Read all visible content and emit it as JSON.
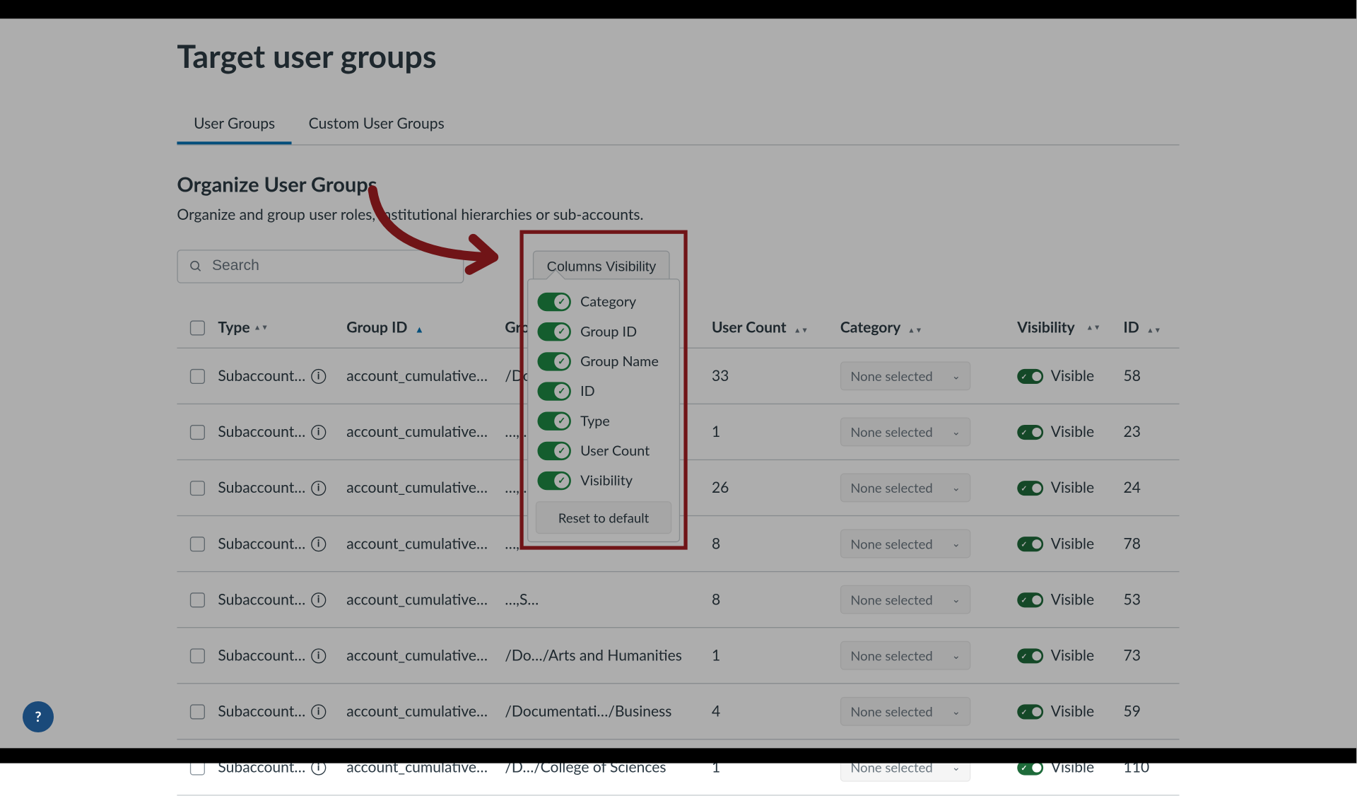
{
  "page": {
    "title": "Target user groups"
  },
  "tabs": [
    {
      "label": "User Groups",
      "active": true
    },
    {
      "label": "Custom User Groups",
      "active": false
    }
  ],
  "section": {
    "title": "Organize User Groups",
    "subtitle": "Organize and group user roles, institutional hierarchies or sub-accounts."
  },
  "search": {
    "placeholder": "Search"
  },
  "columns_visibility": {
    "button_label": "Columns Visibility",
    "options": [
      {
        "label": "Category",
        "on": true
      },
      {
        "label": "Group ID",
        "on": true
      },
      {
        "label": "Group Name",
        "on": true
      },
      {
        "label": "ID",
        "on": true
      },
      {
        "label": "Type",
        "on": true
      },
      {
        "label": "User Count",
        "on": true
      },
      {
        "label": "Visibility",
        "on": true
      }
    ],
    "reset_label": "Reset to default"
  },
  "columns": [
    {
      "label": "Type"
    },
    {
      "label": "Group ID",
      "sorted_asc": true
    },
    {
      "label": "Group Name"
    },
    {
      "label": "User Count"
    },
    {
      "label": "Category"
    },
    {
      "label": "Visibility"
    },
    {
      "label": "ID"
    }
  ],
  "category_none": "None selected",
  "visibility_label": "Visible",
  "rows": [
    {
      "type": "Subaccount…",
      "group_id": "account_cumulative…",
      "group_name": "/Do…",
      "user_count": "33",
      "id": "58"
    },
    {
      "type": "Subaccount…",
      "group_id": "account_cumulative…",
      "group_name": "…,…",
      "user_count": "1",
      "id": "23"
    },
    {
      "type": "Subaccount…",
      "group_id": "account_cumulative…",
      "group_name": "…,…",
      "user_count": "26",
      "id": "24"
    },
    {
      "type": "Subaccount…",
      "group_id": "account_cumulative…",
      "group_name": "…,…",
      "user_count": "8",
      "id": "78"
    },
    {
      "type": "Subaccount…",
      "group_id": "account_cumulative…",
      "group_name": "…,S…",
      "user_count": "8",
      "id": "53"
    },
    {
      "type": "Subaccount…",
      "group_id": "account_cumulative…",
      "group_name": "/Do…/Arts and Humanities",
      "user_count": "1",
      "id": "73"
    },
    {
      "type": "Subaccount…",
      "group_id": "account_cumulative…",
      "group_name": "/Documentati…/Business",
      "user_count": "4",
      "id": "59"
    },
    {
      "type": "Subaccount…",
      "group_id": "account_cumulative…",
      "group_name": "/D…/College of Sciences",
      "user_count": "1",
      "id": "110"
    }
  ],
  "help_icon": "?",
  "annotation": {
    "highlight_color": "#a51e22"
  }
}
